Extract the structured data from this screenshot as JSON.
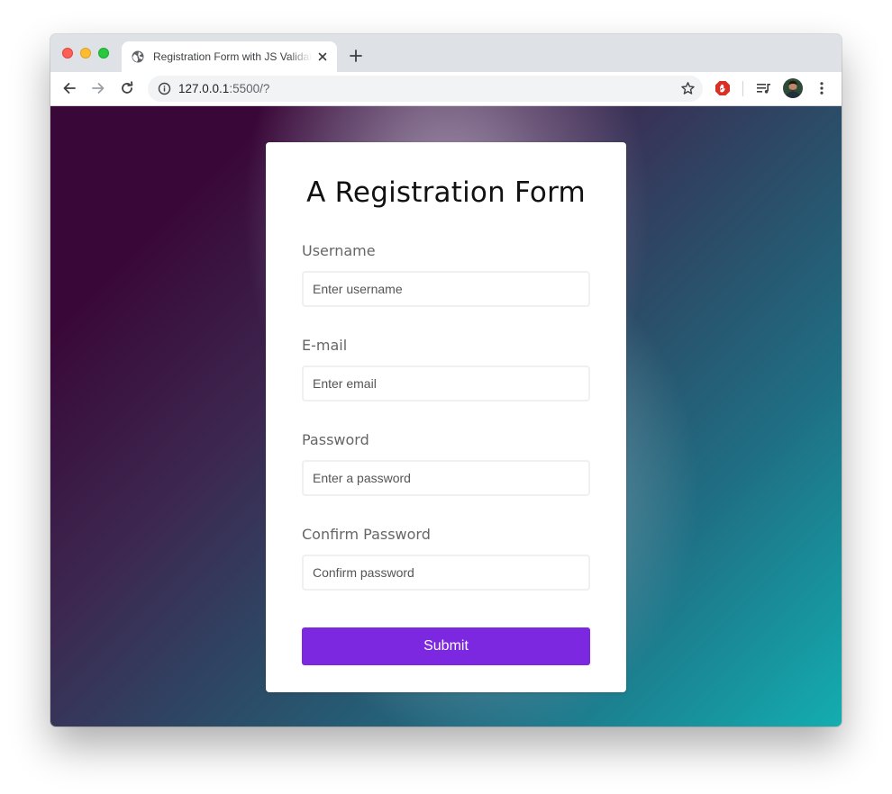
{
  "browser": {
    "tab": {
      "title": "Registration Form with JS Validation"
    },
    "address_bar": {
      "host": "127.0.0.1",
      "rest": ":5500/?"
    },
    "icons": {
      "back": "arrow-left-icon",
      "forward": "arrow-right-icon",
      "reload": "reload-icon",
      "info": "info-icon",
      "bookmark": "star-icon",
      "adblock": "adblock-icon",
      "media": "media-playlist-icon",
      "menu": "kebab-menu-icon"
    }
  },
  "form": {
    "title": "A Registration Form",
    "fields": [
      {
        "label": "Username",
        "placeholder": "Enter username",
        "value": ""
      },
      {
        "label": "E-mail",
        "placeholder": "Enter email",
        "value": ""
      },
      {
        "label": "Password",
        "placeholder": "Enter a password",
        "value": ""
      },
      {
        "label": "Confirm Password",
        "placeholder": "Confirm password",
        "value": ""
      }
    ],
    "submit_label": "Submit"
  },
  "colors": {
    "accent": "#7c27e0",
    "background_start": "#3a0838",
    "background_end": "#13adb0"
  }
}
